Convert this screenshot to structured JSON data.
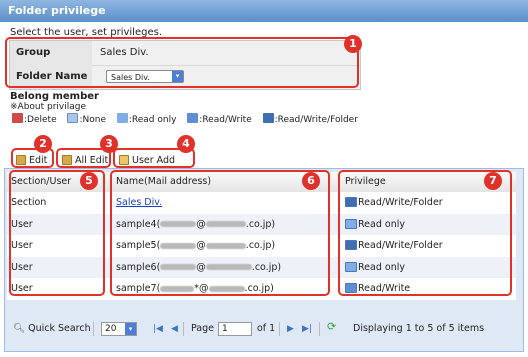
{
  "header": {
    "title": "Folder privilege"
  },
  "instructions": "Select the user, set privileges.",
  "info": {
    "group_label": "Group",
    "group_value": "Sales Div.",
    "folder_label": "Folder Name",
    "folder_select": "Sales Div."
  },
  "belong": {
    "title": "Belong member",
    "about": "※About privilage",
    "legend": [
      {
        "icon": "delete-icon",
        "label": ":Delete"
      },
      {
        "icon": "none-icon",
        "label": ":None"
      },
      {
        "icon": "read-only-icon",
        "label": ":Read only"
      },
      {
        "icon": "read-write-icon",
        "label": ":Read/Write"
      },
      {
        "icon": "read-write-folder-icon",
        "label": ":Read/Write/Folder"
      }
    ]
  },
  "toolbar": {
    "edit": "Edit",
    "all_edit": "All Edit",
    "user_add": "User Add"
  },
  "table": {
    "headers": [
      "Section/User",
      "Name(Mail address)",
      "Privilege"
    ],
    "rows": [
      {
        "type": "Section",
        "name": "Sales Div.",
        "privilege": "Read/Write/Folder"
      },
      {
        "type": "User",
        "name_prefix": "sample4(",
        "name_at": "@",
        "name_suffix": ".co.jp)",
        "privilege": "Read only"
      },
      {
        "type": "User",
        "name_prefix": "sample5(",
        "name_at": "@",
        "name_suffix": ".co.jp)",
        "privilege": "Read/Write/Folder"
      },
      {
        "type": "User",
        "name_prefix": "sample6(",
        "name_at": "@",
        "name_suffix": ".co.jp)",
        "privilege": "Read only"
      },
      {
        "type": "User",
        "name_prefix": "sample7(",
        "name_at": "*@",
        "name_suffix": ".co.jp)",
        "privilege": "Read/Write"
      }
    ]
  },
  "pager": {
    "quick_search": "Quick Search",
    "page_size": "20",
    "page_label": "Page",
    "page_value": "1",
    "of_label": "of 1",
    "status": "Displaying 1 to 5 of 5 items"
  },
  "callouts": [
    "1",
    "2",
    "3",
    "4",
    "5",
    "6",
    "7"
  ],
  "colors": {
    "accent": "#e0322a",
    "header": "#6f9fd6",
    "link": "#1a3fbf"
  }
}
